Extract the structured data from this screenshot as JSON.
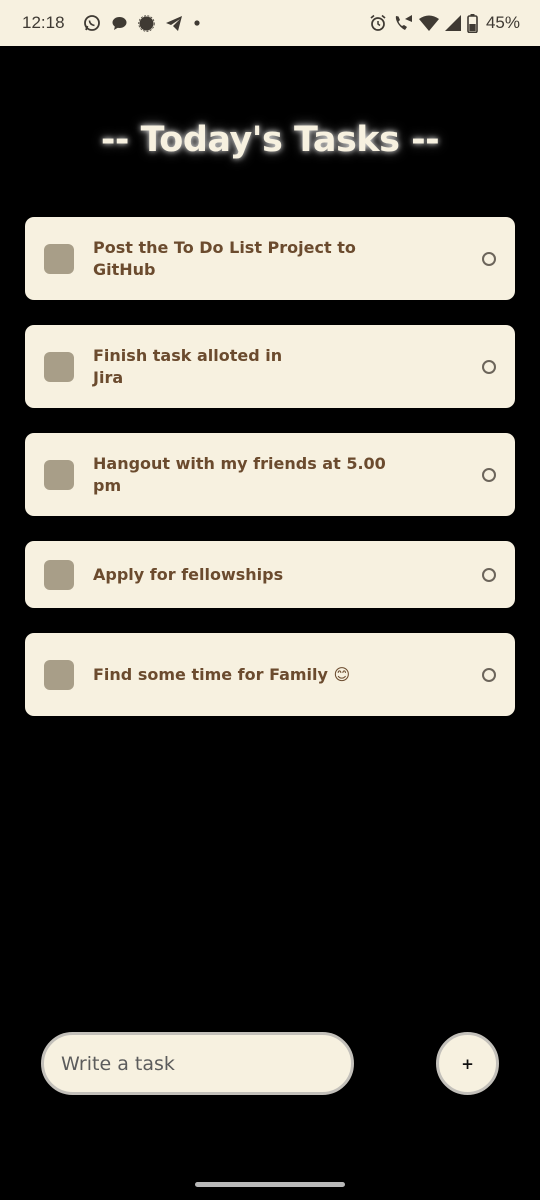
{
  "status_bar": {
    "time": "12:18",
    "battery": "45%",
    "left_icons": [
      "whatsapp-icon",
      "chat-bubble-icon",
      "signal-app-icon",
      "telegram-icon",
      "dot-icon"
    ],
    "right_icons": [
      "alarm-icon",
      "wifi-calling-icon",
      "wifi-icon",
      "cell-signal-icon",
      "battery-icon"
    ]
  },
  "header": {
    "title": "-- Today's Tasks --"
  },
  "tasks": [
    {
      "text": "Post the To Do List Project to GitHub"
    },
    {
      "text": "Finish task alloted in Jira"
    },
    {
      "text": "Hangout with my friends at 5.00 pm"
    },
    {
      "text": "Apply for fellowships"
    },
    {
      "text": "Find some time for Family 😊"
    }
  ],
  "composer": {
    "placeholder": "Write a task",
    "add_label": "+"
  },
  "colors": {
    "background": "#000000",
    "card": "#f7f1e0",
    "checkbox": "#a89e88",
    "task_text": "#6b4b2e"
  }
}
